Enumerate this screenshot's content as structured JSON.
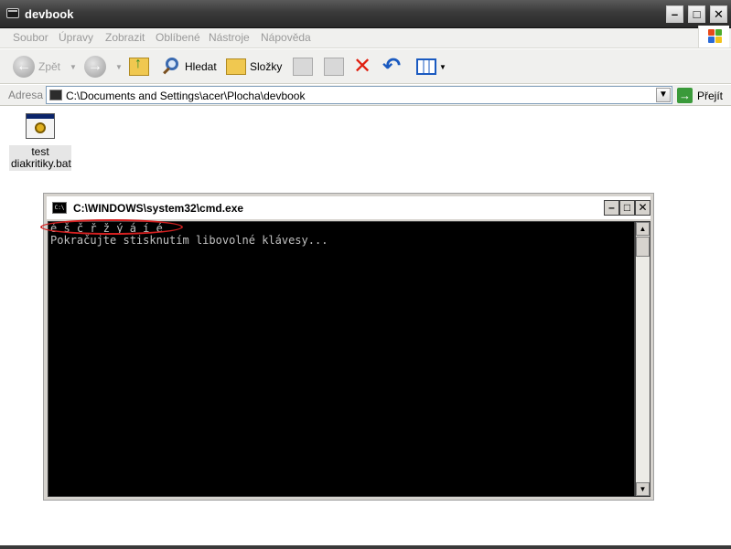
{
  "window": {
    "title": "devbook",
    "controls": {
      "minimize": "–",
      "maximize": "□",
      "close": "✕"
    }
  },
  "menu": [
    "Soubor",
    "Úpravy",
    "Zobrazit",
    "Oblíbené",
    "Nástroje",
    "Nápověda"
  ],
  "toolbar": {
    "back_label": "Zpět",
    "search_label": "Hledat",
    "folders_label": "Složky"
  },
  "address": {
    "label": "Adresa",
    "value": "C:\\Documents and Settings\\acer\\Plocha\\devbook",
    "go_label": "Přejít"
  },
  "files": [
    {
      "name": "test diakritiky.bat",
      "icon": "batch-file-icon"
    }
  ],
  "cmd": {
    "title": "C:\\WINDOWS\\system32\\cmd.exe",
    "icon_text": "C:\\",
    "lines": [
      "é š č ř ž ý á í é",
      "Pokračujte stisknutím libovolné klávesy..."
    ],
    "highlight_color": "#d42020"
  },
  "colors": {
    "titlebar": "#3a3a3a",
    "console_bg": "#000000",
    "console_text": "#c0c0c0"
  }
}
